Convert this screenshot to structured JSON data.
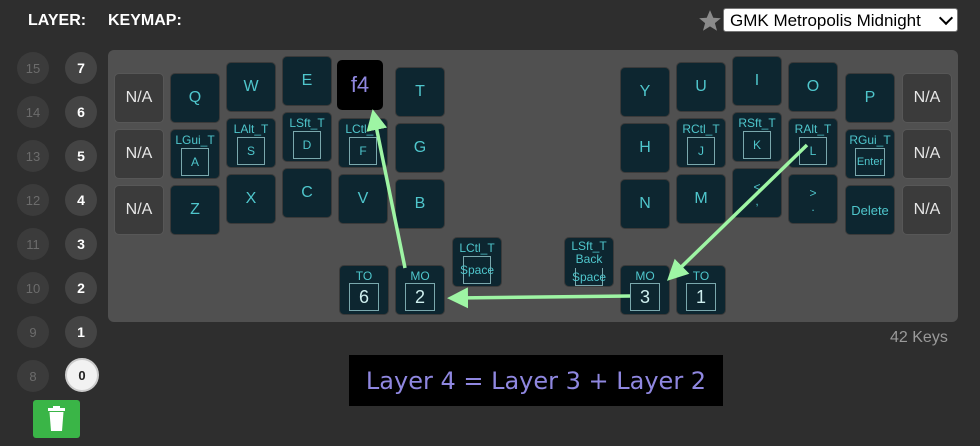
{
  "header": {
    "layer_label": "LAYER:",
    "keymap_label": "KEYMAP:"
  },
  "theme_select": {
    "value": "GMK Metropolis Midnight",
    "icon": "star-icon"
  },
  "layers": {
    "left_column": [
      "15",
      "14",
      "13",
      "12",
      "11",
      "10",
      "9",
      "8"
    ],
    "right_column": [
      "7",
      "6",
      "5",
      "4",
      "3",
      "2",
      "1",
      "0"
    ],
    "selected": "0"
  },
  "keys": {
    "na1": "N/A",
    "na2": "N/A",
    "na3": "N/A",
    "na4": "N/A",
    "na5": "N/A",
    "na6": "N/A",
    "q": "Q",
    "w": "W",
    "e": "E",
    "r": "f4",
    "t": "T",
    "a_top": "LGui_T",
    "a": "A",
    "s_top": "LAlt_T",
    "s": "S",
    "d_top": "LSft_T",
    "d": "D",
    "f_top": "LCtl_T",
    "f": "F",
    "g": "G",
    "z": "Z",
    "x": "X",
    "c": "C",
    "v": "V",
    "b": "B",
    "y": "Y",
    "u": "U",
    "i": "I",
    "o": "O",
    "p": "P",
    "h": "H",
    "j_top": "RCtl_T",
    "j": "J",
    "k_top": "RSft_T",
    "k": "K",
    "l_top": "RAlt_T",
    "l": "L",
    "enter_top": "RGui_T",
    "enter": "Enter",
    "n": "N",
    "m": "M",
    "comma_top": "<",
    "comma": ",",
    "dot_top": ">",
    "dot": ".",
    "delete": "Delete",
    "th1_top": "TO",
    "th1": "6",
    "th2_top": "MO",
    "th2": "2",
    "th3_top": "LCtl_T",
    "th3": "Space",
    "th4_top": "LSft_T Back",
    "th4": "Space",
    "th5_top": "MO",
    "th5": "3",
    "th6_top": "TO",
    "th6": "1"
  },
  "key_count": "42 Keys",
  "banner": "Layer 4 = Layer 3 + Layer 2",
  "colors": {
    "arrow": "#9ef5a4",
    "legend": "#4fc6cc",
    "key_bg": "#0d2630",
    "highlight_text": "#8f87e0",
    "trash": "#3ab547"
  }
}
